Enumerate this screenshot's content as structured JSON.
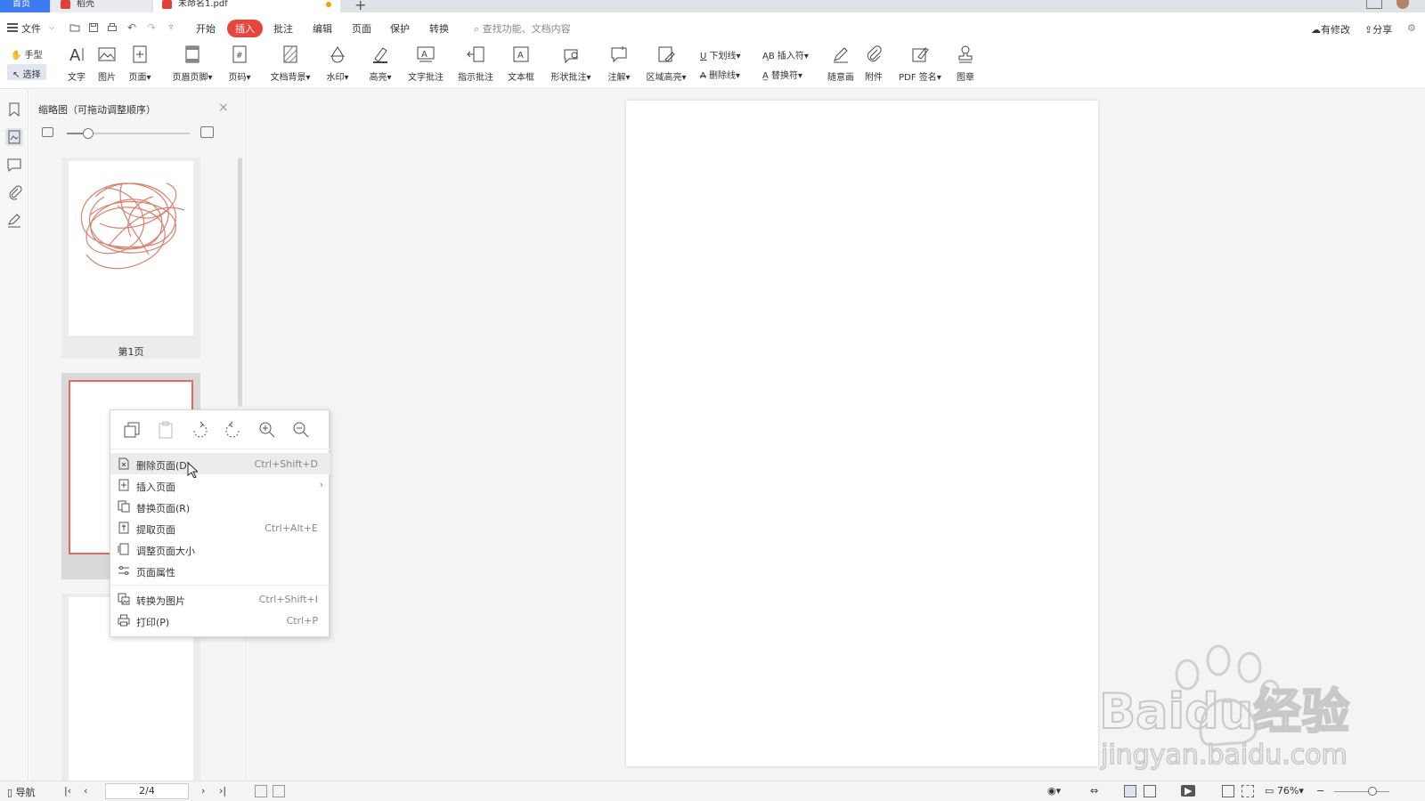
{
  "tabs": {
    "home": "首页",
    "straw": "稻壳",
    "document": "未命名1.pdf",
    "new_tab": "+"
  },
  "menu": {
    "file": "文件",
    "items": [
      "开始",
      "插入",
      "批注",
      "编辑",
      "页面",
      "保护",
      "转换"
    ],
    "active": "插入",
    "search_placeholder": "查找功能、文档内容",
    "modified": "有修改",
    "share": "分享"
  },
  "toolbar": {
    "hand": "手型",
    "select": "选择",
    "text": "文字",
    "image": "图片",
    "page": "页面",
    "header_footer": "页眉页脚",
    "page_number": "页码",
    "doc_background": "文档背景",
    "watermark": "水印",
    "highlight": "高亮",
    "text_comment": "文字批注",
    "pointer_comment": "指示批注",
    "textbox": "文本框",
    "shape_comment": "形状批注",
    "note": "注解",
    "area_highlight": "区域高亮",
    "underline": "下划线",
    "strikethrough": "删除线",
    "insert_symbol": "插入符",
    "replace_symbol": "替换符",
    "freehand": "随意画",
    "attachment": "附件",
    "pdf_sign": "PDF 签名",
    "stamp": "图章"
  },
  "panel": {
    "title": "缩略图（可拖动调整顺序）",
    "close": "×",
    "thumbnails": [
      {
        "label": "第1页"
      }
    ]
  },
  "context_menu": {
    "items": [
      {
        "label": "删除页面(D)",
        "shortcut": "Ctrl+Shift+D"
      },
      {
        "label": "插入页面",
        "shortcut": ""
      },
      {
        "label": "替换页面(R)",
        "shortcut": ""
      },
      {
        "label": "提取页面",
        "shortcut": "Ctrl+Alt+E"
      },
      {
        "label": "调整页面大小",
        "shortcut": ""
      },
      {
        "label": "页面属性",
        "shortcut": ""
      },
      {
        "label": "转换为图片",
        "shortcut": "Ctrl+Shift+I"
      },
      {
        "label": "打印(P)",
        "shortcut": "Ctrl+P"
      }
    ],
    "submenu_arrow": "›"
  },
  "statusbar": {
    "nav": "导航",
    "page_indicator": "2/4",
    "zoom": "76%",
    "zoom_minus": "−"
  },
  "watermark": {
    "brand": "Baidu经验",
    "url": "jingyan.baidu.com"
  },
  "colors": {
    "accent_red": "#e8453c",
    "home_tab_blue": "#3c7cf0",
    "selected_thumb_border": "#e8675f"
  }
}
